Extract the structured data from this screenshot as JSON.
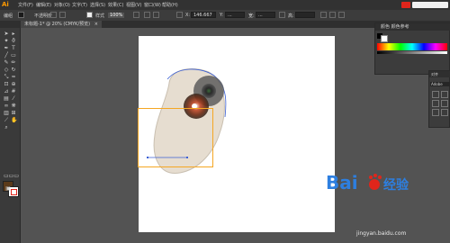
{
  "app": {
    "logo": "Ai",
    "menu": [
      "文件(F)",
      "编辑(E)",
      "对象(O)",
      "文字(T)",
      "选择(S)",
      "效果(C)",
      "视图(V)",
      "窗口(W)",
      "帮助(H)"
    ]
  },
  "control_bar": {
    "selection_label": "编组",
    "opacity_label": "不透明度",
    "opacity_value": "100%",
    "style_label": "样式",
    "x_label": "X:",
    "x_value": "146.667",
    "y_label": "Y:",
    "y_value": "...",
    "w_label": "宽:",
    "w_value": "...",
    "h_label": "高:"
  },
  "document_tab": {
    "title": "未标题-1* @ 20% (CMYK/预览)",
    "close": "×"
  },
  "panels": {
    "swatches_header": "颜色 颜色参考",
    "transform_header": "对齐",
    "transform_label": "Adobe"
  },
  "watermark": {
    "brand": "Bai",
    "brand_cn": "经验",
    "url": "jingyan.baidu.com"
  },
  "colors": {
    "selection_box": "#f5a623",
    "path_blue": "#3b5fd4",
    "brand_red": "#e0251b",
    "brand_blue": "#2d7fe0"
  },
  "icons": [
    "selection-tool-icon",
    "direct-selection-tool-icon",
    "magic-wand-icon",
    "lasso-icon",
    "pen-tool-icon",
    "type-tool-icon",
    "line-tool-icon",
    "rectangle-tool-icon",
    "brush-tool-icon",
    "pencil-tool-icon",
    "eraser-tool-icon",
    "rotate-tool-icon",
    "scale-tool-icon",
    "width-tool-icon",
    "free-transform-icon",
    "shape-builder-icon",
    "perspective-icon",
    "mesh-icon",
    "gradient-icon",
    "eyedropper-icon",
    "blend-icon",
    "symbol-sprayer-icon",
    "graph-icon",
    "artboard-icon",
    "slice-icon",
    "hand-tool-icon",
    "zoom-tool-icon"
  ]
}
